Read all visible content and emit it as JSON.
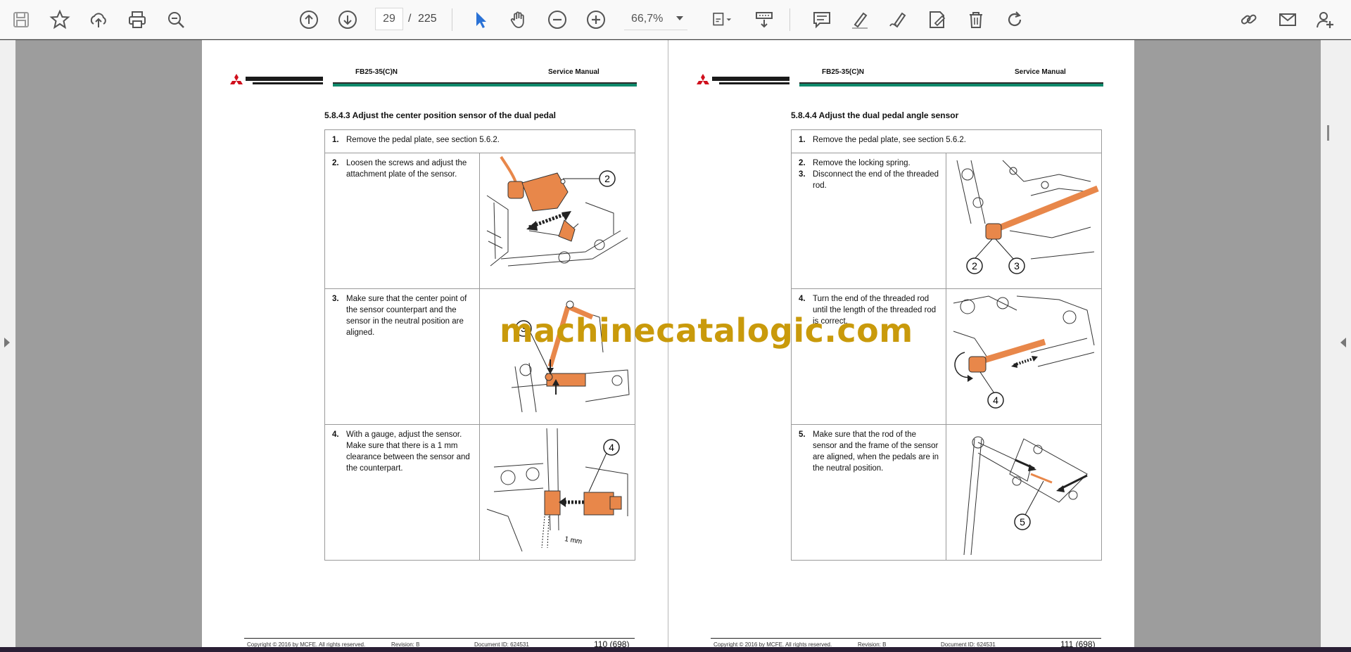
{
  "toolbar": {
    "current_page": "29",
    "separator": "/",
    "total_pages": "225",
    "zoom": "66,7%"
  },
  "watermark": "machinecatalogic.com",
  "pages": {
    "left": {
      "model": "FB25-35(C)N",
      "manual": "Service Manual",
      "section": "5.8.4.3   Adjust the center position sensor of the dual pedal",
      "steps": [
        {
          "num": "1.",
          "text": "Remove the pedal plate, see section 5.6.2."
        },
        {
          "num": "2.",
          "text": "Loosen the screws and adjust the attachment plate of the sensor.",
          "callouts": [
            "2"
          ]
        },
        {
          "num": "3.",
          "text": "Make sure that the center point of the sensor counterpart and the sensor in the neutral position are aligned.",
          "callouts": [
            "3"
          ]
        },
        {
          "num": "4.",
          "text": "With a gauge, adjust the sensor. Make sure that there is a 1 mm clearance between the sensor and the counterpart.",
          "callouts": [
            "4"
          ],
          "dimension": "1 mm"
        }
      ],
      "footer": {
        "copyright": "Copyright © 2016 by MCFE. All rights reserved.",
        "revision": "Revision: B",
        "document": "Document ID: 624531",
        "page": "110 (698)"
      }
    },
    "right": {
      "model": "FB25-35(C)N",
      "manual": "Service Manual",
      "section": "5.8.4.4   Adjust the dual pedal angle sensor",
      "steps": [
        {
          "num": "1.",
          "text": "Remove the pedal plate, see section 5.6.2."
        },
        {
          "num": "2.",
          "text": "Remove the locking spring.",
          "num2": "3.",
          "text2": "Disconnect the end of the threaded rod.",
          "callouts": [
            "2",
            "3"
          ]
        },
        {
          "num": "4.",
          "text": "Turn the end of the threaded rod until the length of the threaded rod is correct.",
          "callouts": [
            "4"
          ]
        },
        {
          "num": "5.",
          "text": "Make sure that the rod of the sensor and the frame of the sensor are aligned, when the pedals are in the neutral position.",
          "callouts": [
            "5"
          ]
        }
      ],
      "footer": {
        "copyright": "Copyright © 2016 by MCFE. All rights reserved.",
        "revision": "Revision: B",
        "document": "Document ID: 624531",
        "page": "111 (698)"
      }
    }
  },
  "colors": {
    "accent_orange": "#e8874a",
    "header_green": "#0f8a6c",
    "watermark": "#c99a0b",
    "select_tool": "#2a72d6"
  }
}
